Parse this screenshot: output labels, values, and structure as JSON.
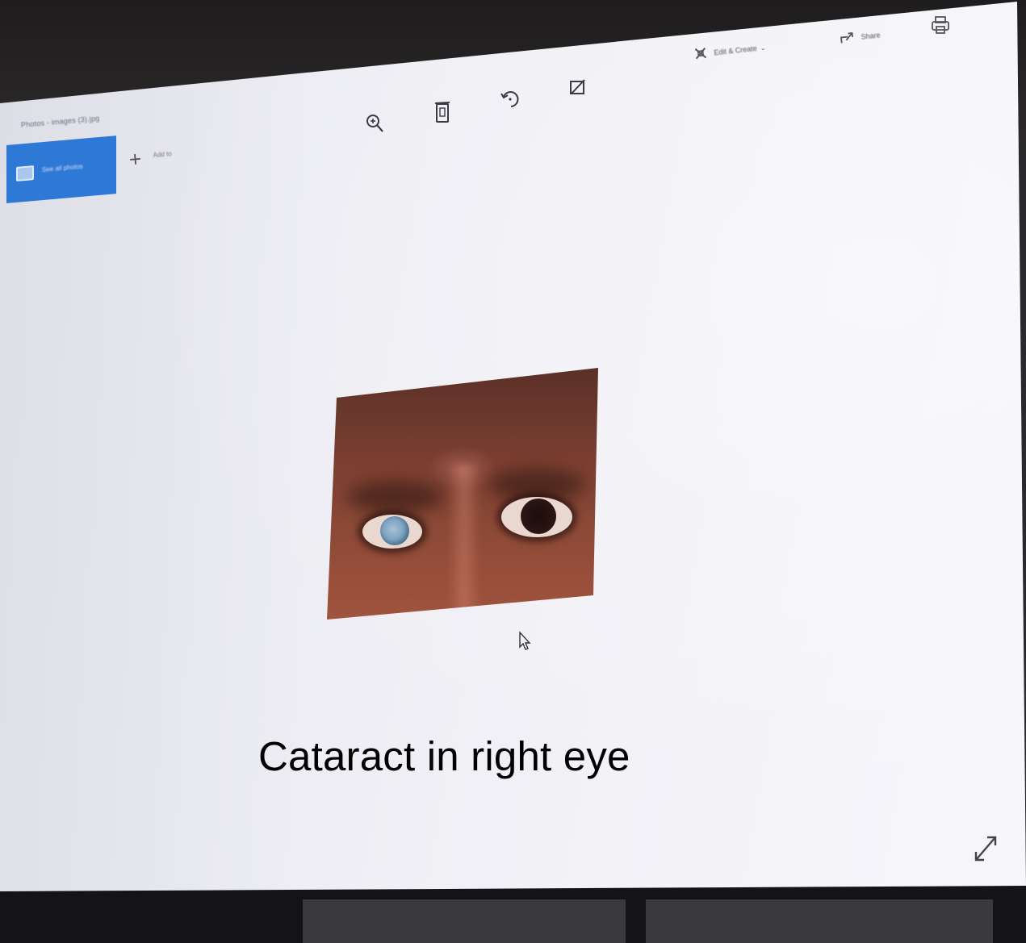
{
  "window": {
    "title": "Photos - images (3).jpg"
  },
  "sidebar": {
    "collection_label": "See all photos",
    "add_to_label": "Add to"
  },
  "toolbar": {
    "zoom_icon": "zoom-in-icon",
    "delete_icon": "trash-icon",
    "rotate_icon": "rotate-icon",
    "crop_icon": "crop-icon",
    "edit_create_label": "Edit & Create",
    "share_label": "Share",
    "print_icon": "print-icon"
  },
  "viewer": {
    "caption": "Cataract in right eye",
    "expand_icon": "expand-icon",
    "cursor_icon": "mouse-pointer-icon"
  },
  "colors": {
    "accent": "#2e78d6",
    "background": "#eeeef4",
    "caption_text": "#000000"
  }
}
